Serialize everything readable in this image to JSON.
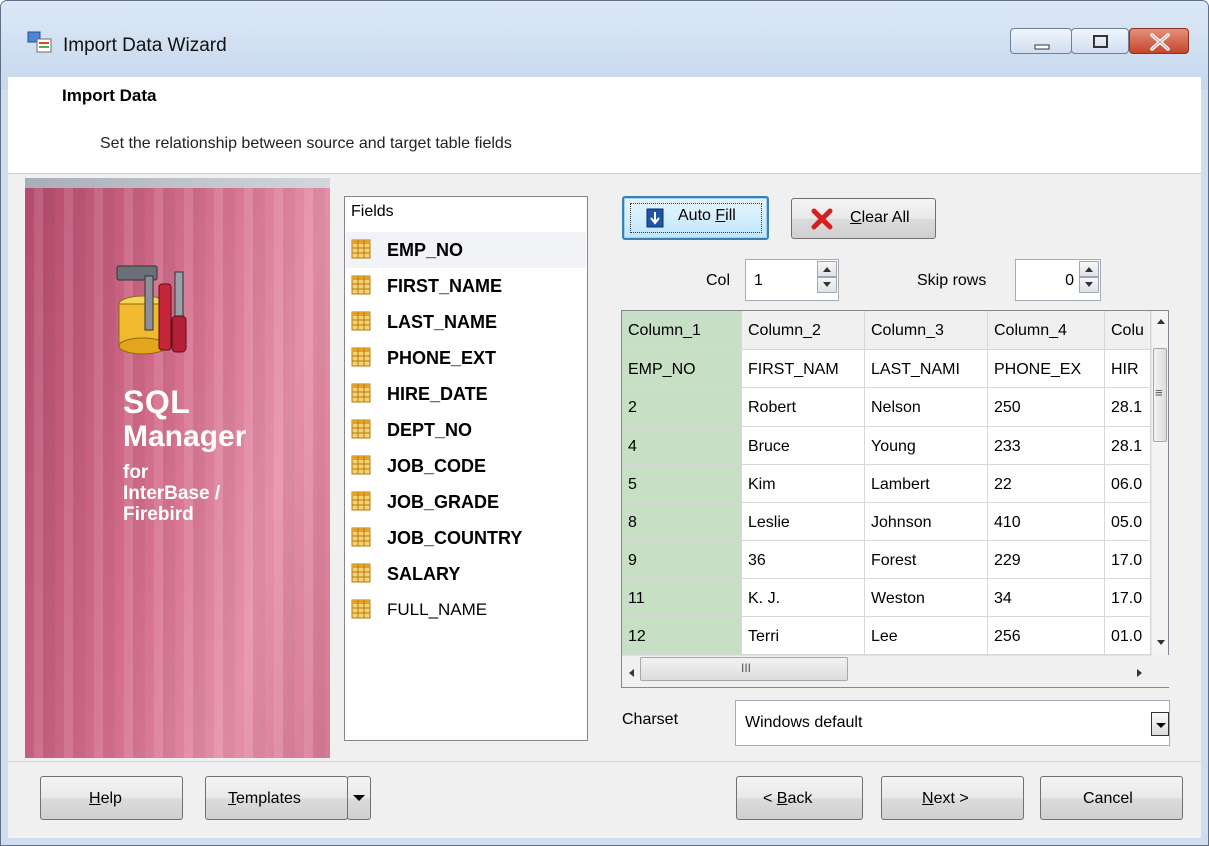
{
  "window": {
    "title": "Import Data Wizard",
    "controls": [
      "minimize-icon",
      "maximize-icon",
      "close-icon"
    ]
  },
  "header": {
    "title": "Import Data",
    "subtitle": "Set the relationship between source and target table fields"
  },
  "banner": {
    "line1": "SQL",
    "line2": "Manager",
    "line3": "for",
    "line4": "InterBase /",
    "line5": "Firebird"
  },
  "fields": {
    "header": "Fields",
    "items": [
      {
        "label": "EMP_NO",
        "bold": true,
        "selected": true
      },
      {
        "label": "FIRST_NAME",
        "bold": true
      },
      {
        "label": "LAST_NAME",
        "bold": true
      },
      {
        "label": "PHONE_EXT",
        "bold": true
      },
      {
        "label": "HIRE_DATE",
        "bold": true
      },
      {
        "label": "DEPT_NO",
        "bold": true
      },
      {
        "label": "JOB_CODE",
        "bold": true
      },
      {
        "label": "JOB_GRADE",
        "bold": true
      },
      {
        "label": "JOB_COUNTRY",
        "bold": true
      },
      {
        "label": "SALARY",
        "bold": true
      },
      {
        "label": "FULL_NAME",
        "bold": false
      }
    ]
  },
  "toolbar": {
    "autofill_pre": "Auto ",
    "autofill_key": "F",
    "autofill_post": "ill",
    "clear_key": "C",
    "clear_post": "lear All"
  },
  "col": {
    "label": "Col",
    "value": "1"
  },
  "skip": {
    "label": "Skip rows",
    "value": "0"
  },
  "grid": {
    "headers": [
      "Column_1",
      "Column_2",
      "Column_3",
      "Column_4",
      "Colu"
    ],
    "rows": [
      [
        "EMP_NO",
        "FIRST_NAM",
        "LAST_NAMI",
        "PHONE_EX",
        "HIR"
      ],
      [
        "2",
        "Robert",
        "Nelson",
        "250",
        "28.1"
      ],
      [
        "4",
        "Bruce",
        "Young",
        "233",
        "28.1"
      ],
      [
        "5",
        "Kim",
        "Lambert",
        "22",
        "06.0"
      ],
      [
        "8",
        "Leslie",
        "Johnson",
        "410",
        "05.0"
      ],
      [
        "9",
        "36",
        "Forest",
        "229",
        "17.0"
      ],
      [
        "11",
        "K. J.",
        "Weston",
        "34",
        "17.0"
      ],
      [
        "12",
        "Terri",
        "Lee",
        "256",
        "01.0"
      ]
    ],
    "hscroll_mark": "III",
    "vscroll_mark": "≡"
  },
  "charset": {
    "label": "Charset",
    "value": "Windows default"
  },
  "footer": {
    "help_key": "H",
    "help_post": "elp",
    "templates_key": "T",
    "templates_post": "emplates",
    "back_pre": "< ",
    "back_key": "B",
    "back_post": "ack",
    "next_key": "N",
    "next_post": "ext >",
    "cancel": "Cancel"
  },
  "colors": {
    "accent": "#3c7fb1",
    "selected_column": "#c7dfc4",
    "banner": "#d46f8d",
    "close_button": "#c4452b"
  }
}
